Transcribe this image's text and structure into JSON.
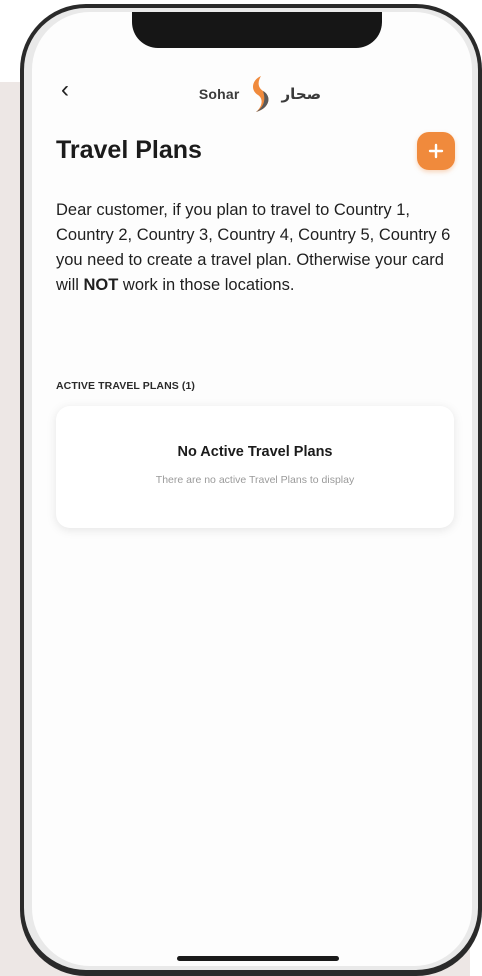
{
  "nav": {
    "back_icon": "chevron-left-icon",
    "back_glyph": "‹",
    "logo_latin": "Sohar",
    "logo_arabic": "صحار"
  },
  "header": {
    "title": "Travel Plans",
    "add_icon": "plus-icon",
    "add_color": "#f08a3c"
  },
  "intro": {
    "text_before": "Dear customer, if you plan to travel to Country 1, Country 2, Country 3, Country 4, Country 5, Country 6  you need to create a travel plan. Otherwise your card will ",
    "emphasis": "NOT",
    "text_after": " work in those locations."
  },
  "active_section": {
    "label": "ACTIVE TRAVEL PLANS (1)",
    "empty_title": "No Active Travel Plans",
    "empty_subtitle": "There are no active Travel Plans to display"
  }
}
